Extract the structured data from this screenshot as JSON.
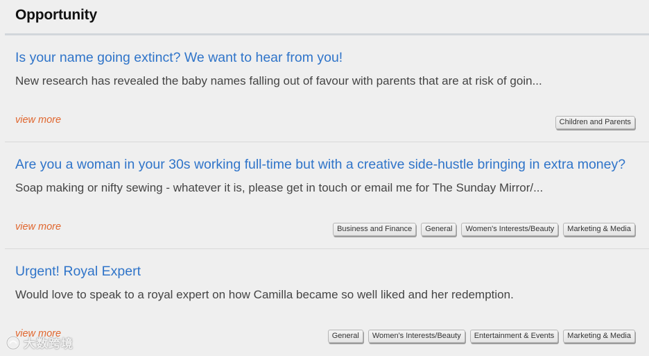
{
  "header": {
    "title": "Opportunity"
  },
  "items": [
    {
      "title": "Is your name going extinct? We want to hear from you!",
      "description": "New research has revealed the baby names falling out of favour with parents that are at risk of goin...",
      "view_more": "view more",
      "tags": [
        "Children and Parents"
      ]
    },
    {
      "title": "Are you a woman in your 30s working full-time but with a creative side-hustle bringing in extra money?",
      "description": "Soap making or nifty sewing - whatever it is, please get in touch or email me for The Sunday Mirror/...",
      "view_more": "view more",
      "tags": [
        "Business and Finance",
        "General",
        "Women's Interests/Beauty",
        "Marketing & Media"
      ]
    },
    {
      "title": "Urgent! Royal Expert",
      "description": "Would love to speak to a royal expert on how Camilla became so well liked and her redemption.",
      "view_more": "view more",
      "tags": [
        "General",
        "Women's Interests/Beauty",
        "Entertainment & Events",
        "Marketing & Media"
      ]
    }
  ],
  "watermark": {
    "text": "大数跨境",
    "icon": "cross-border-logo-icon"
  },
  "colors": {
    "link_blue": "#2f74c9",
    "view_more_orange": "#e0662e",
    "background": "#efefef"
  }
}
